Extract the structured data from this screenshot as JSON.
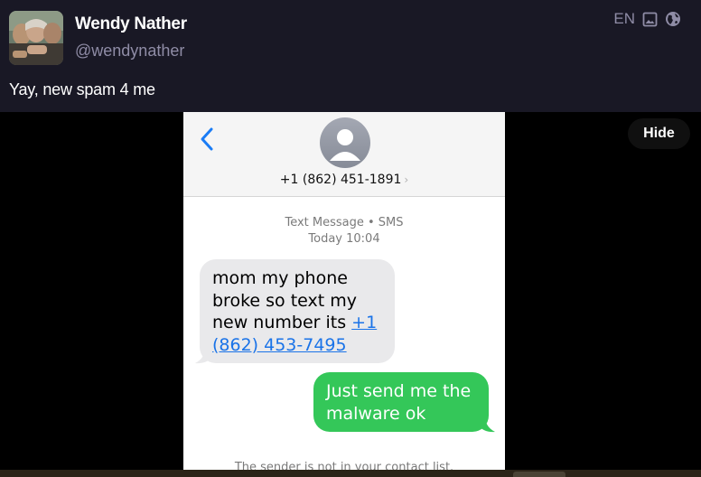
{
  "post": {
    "display_name": "Wendy Nather",
    "handle": "@wendynather",
    "language": "EN",
    "text": "Yay, new spam 4 me"
  },
  "media": {
    "hide_label": "Hide",
    "screenshot": {
      "contact_number": "+1 (862) 451-1891",
      "contact_chevron": "›",
      "message_type": "Text Message • SMS",
      "timestamp": "Today 10:04",
      "incoming_text": "mom my phone broke so text my new number its ",
      "incoming_link": "+1 (862) 453-7495",
      "outgoing_text": "Just send me the malware ok",
      "footer": "The sender is not in your contact list."
    }
  },
  "colors": {
    "background": "#191825",
    "muted": "#8f8ca6",
    "incoming_bubble": "#e9e9eb",
    "outgoing_bubble": "#34c759",
    "link": "#1a73e8",
    "ios_blue": "#1a7cf5"
  },
  "icons": [
    "image-icon",
    "globe-icon",
    "back-chevron-icon",
    "contact-avatar-icon"
  ]
}
